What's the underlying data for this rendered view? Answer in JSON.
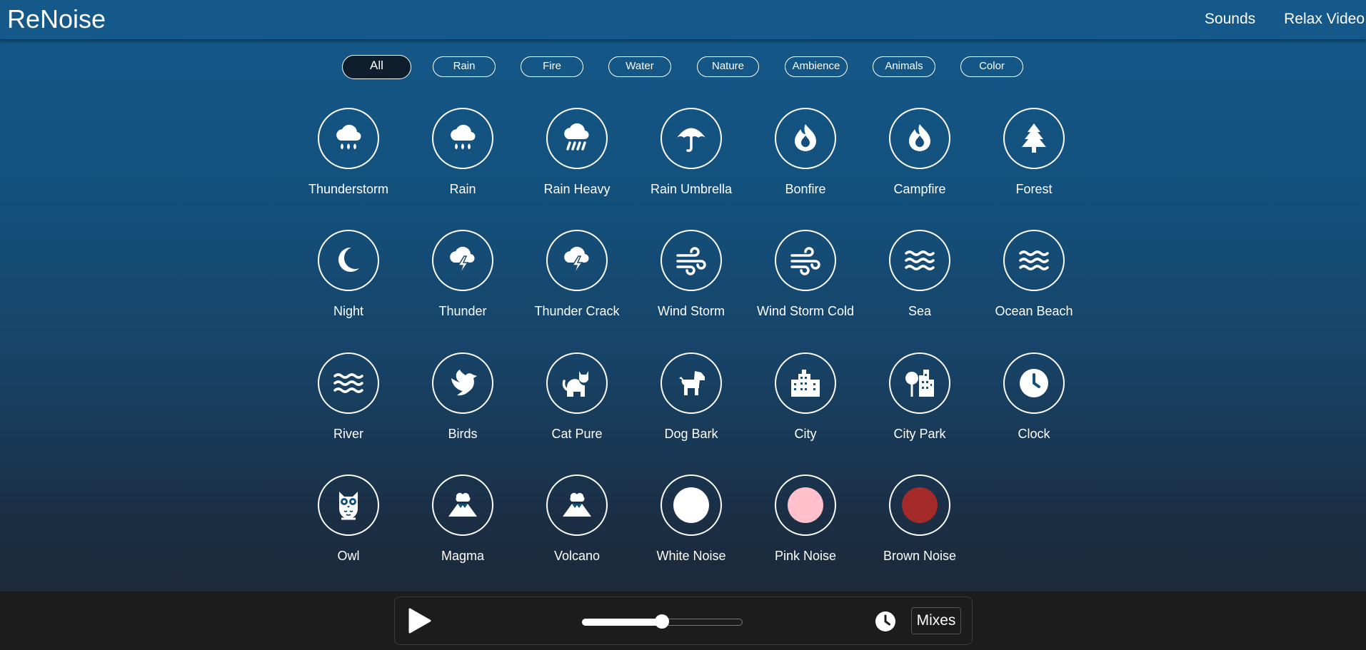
{
  "brand": "ReNoise",
  "nav": [
    "Sounds",
    "Relax Video"
  ],
  "categories": [
    "All",
    "Rain",
    "Fire",
    "Water",
    "Nature",
    "Ambience",
    "Animals",
    "Color"
  ],
  "active_category": "All",
  "sounds": [
    {
      "label": "Thunderstorm",
      "icon": "cloud-rain-icon"
    },
    {
      "label": "Rain",
      "icon": "cloud-rain-icon"
    },
    {
      "label": "Rain Heavy",
      "icon": "cloud-showers-heavy-icon"
    },
    {
      "label": "Rain Umbrella",
      "icon": "umbrella-icon"
    },
    {
      "label": "Bonfire",
      "icon": "fire-icon"
    },
    {
      "label": "Campfire",
      "icon": "fire-icon"
    },
    {
      "label": "Forest",
      "icon": "tree-icon"
    },
    {
      "label": "Night",
      "icon": "moon-icon"
    },
    {
      "label": "Thunder",
      "icon": "cloud-bolt-icon"
    },
    {
      "label": "Thunder Crack",
      "icon": "cloud-bolt-icon"
    },
    {
      "label": "Wind Storm",
      "icon": "wind-icon"
    },
    {
      "label": "Wind Storm Cold",
      "icon": "wind-icon"
    },
    {
      "label": "Sea",
      "icon": "water-waves-icon"
    },
    {
      "label": "Ocean Beach",
      "icon": "water-waves-icon"
    },
    {
      "label": "River",
      "icon": "water-waves-icon"
    },
    {
      "label": "Birds",
      "icon": "dove-icon"
    },
    {
      "label": "Cat Pure",
      "icon": "cat-icon"
    },
    {
      "label": "Dog Bark",
      "icon": "dog-icon"
    },
    {
      "label": "City",
      "icon": "city-icon"
    },
    {
      "label": "City Park",
      "icon": "tree-city-icon"
    },
    {
      "label": "Clock",
      "icon": "clock-icon"
    },
    {
      "label": "Owl",
      "icon": "owl-icon"
    },
    {
      "label": "Magma",
      "icon": "volcano-icon"
    },
    {
      "label": "Volcano",
      "icon": "volcano-icon"
    },
    {
      "label": "White Noise",
      "icon": "color-dot-icon",
      "color": "#ffffff"
    },
    {
      "label": "Pink Noise",
      "icon": "color-dot-icon",
      "color": "#ffc0cb"
    },
    {
      "label": "Brown Noise",
      "icon": "color-dot-icon",
      "color": "#a52a2a"
    }
  ],
  "player": {
    "play_icon": "play-icon",
    "volume": 0.5,
    "timer_icon": "clock-icon",
    "mixes_label": "Mixes"
  },
  "colors": {
    "header": "#15598a",
    "footer": "#1c1c1c",
    "active_chip": "#0e1e2c"
  }
}
